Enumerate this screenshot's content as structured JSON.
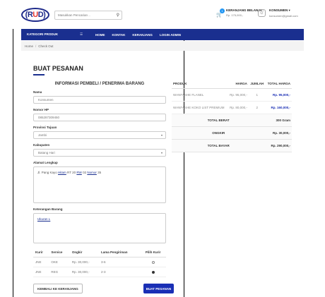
{
  "header": {
    "logo_text_left": "(R",
    "logo_text_mid": "U",
    "logo_text_right": "D)",
    "search_placeholder": "Masukkan Pencarian ..",
    "cart_badge": "1",
    "cart_title": "KERANJANG BELANJA :",
    "cart_amount": "Rp. 175,000,-",
    "user_name": "KONSUMEN ▾",
    "user_email": "konsumen@gmail.com"
  },
  "nav": {
    "category_label": "KATEGORI PRODUK",
    "category_icon": "menu-icon",
    "links": [
      "HOME",
      "KONTAK",
      "KERANJANG",
      "LOGIN ADMIN"
    ]
  },
  "breadcrumb": {
    "home": "Home",
    "sep": "/",
    "current": "Check Out"
  },
  "page_title": "BUAT PESANAN",
  "form": {
    "section_title": "INFORMASI PEMBELI / PENERIMA BARANG",
    "nama_label": "Nama",
    "nama_value": "Konsumen",
    "hp_label": "Nomor HP",
    "hp_value": "085287309450",
    "provinsi_label": "Provinsi Tujuan",
    "provinsi_value": "Jambi",
    "kabupaten_label": "Kabupaten",
    "kabupaten_value": "Batang Hari",
    "alamat_label": "Alamat Lengkap",
    "alamat_prefix": "Jl. Pang Kayo ",
    "alamat_link1": "Hitam",
    "alamat_mid": " RT 20 ",
    "alamat_link2": "RW",
    "alamat_mid2": " 02 ",
    "alamat_link3": "Nomor",
    "alamat_suffix": " 35",
    "keterangan_label": "Keterangan Barang",
    "keterangan_value": "Ukuran L"
  },
  "kurir_table": {
    "headers": [
      "Kurir",
      "Service",
      "Ongkir",
      "Lama Pengiriman",
      "Pilih Kurir"
    ],
    "rows": [
      {
        "kurir": "JNE",
        "service": "OKE",
        "ongkir": "Rp. 30,000,-",
        "lama": "3-6",
        "selected": false
      },
      {
        "kurir": "JNE",
        "service": "REG",
        "ongkir": "Rp. 30,000,-",
        "lama": "2-3",
        "selected": true
      }
    ]
  },
  "buttons": {
    "back": "KEMBALI KE KERANJANG",
    "buy": "BUAT PESANAN"
  },
  "products": {
    "headers": [
      "PRODUK",
      "HARGA",
      "JUMLAH",
      "TOTAL HARGA"
    ],
    "rows": [
      {
        "name": "WANFASHE FLANEL",
        "price": "Rp. 95,000,-",
        "qty": "1",
        "total": "Rp. 95,000,-"
      },
      {
        "name": "WANFASHE KOKO LIST PREMIUM",
        "price": "Rp. 80,000,-",
        "qty": "2",
        "total": "Rp. 160,000,-"
      }
    ],
    "summary": [
      {
        "label": "TOTAL BERAT",
        "value": "300 Gram"
      },
      {
        "label": "ONGKIR",
        "value": "Rp. 30,000,-"
      },
      {
        "label": "TOTAL BAYAR",
        "value": "Rp. 290,000,-"
      }
    ]
  }
}
